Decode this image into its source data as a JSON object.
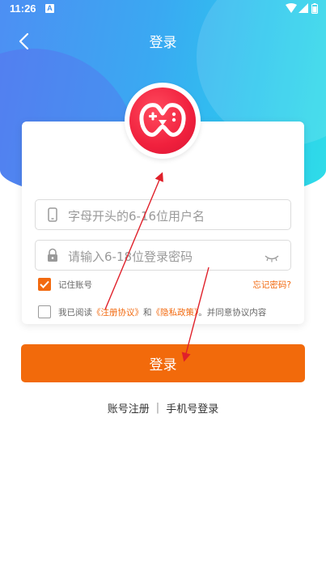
{
  "status_bar": {
    "time": "11:26",
    "notification_glyph": "A"
  },
  "header": {
    "title": "登录"
  },
  "form": {
    "username_placeholder": "字母开头的6-16位用户名",
    "password_placeholder": "请输入6-18位登录密码",
    "remember_label": "记住账号",
    "remember_checked": true,
    "forgot_label": "忘记密码?",
    "agree_checked": false,
    "agree_prefix": "我已阅读",
    "agreement_link": "《注册协议》",
    "and_text": "和",
    "privacy_link": "《隐私政策》",
    "agree_suffix": "。并同意协议内容"
  },
  "login_button": {
    "label": "登录"
  },
  "bottom_links": {
    "register": "账号注册",
    "separator": "|",
    "phone_login": "手机号登录"
  },
  "colors": {
    "accent": "#f26a0b",
    "hero_start": "#4d8ff3",
    "hero_end": "#2fdde8",
    "logo_red": "#f0203d",
    "annotation": "#e0202a"
  },
  "icons": {
    "back": "back-icon",
    "logo": "gamepad-logo-icon",
    "phone": "phone-icon",
    "lock": "lock-icon",
    "eye": "eye-closed-icon"
  }
}
